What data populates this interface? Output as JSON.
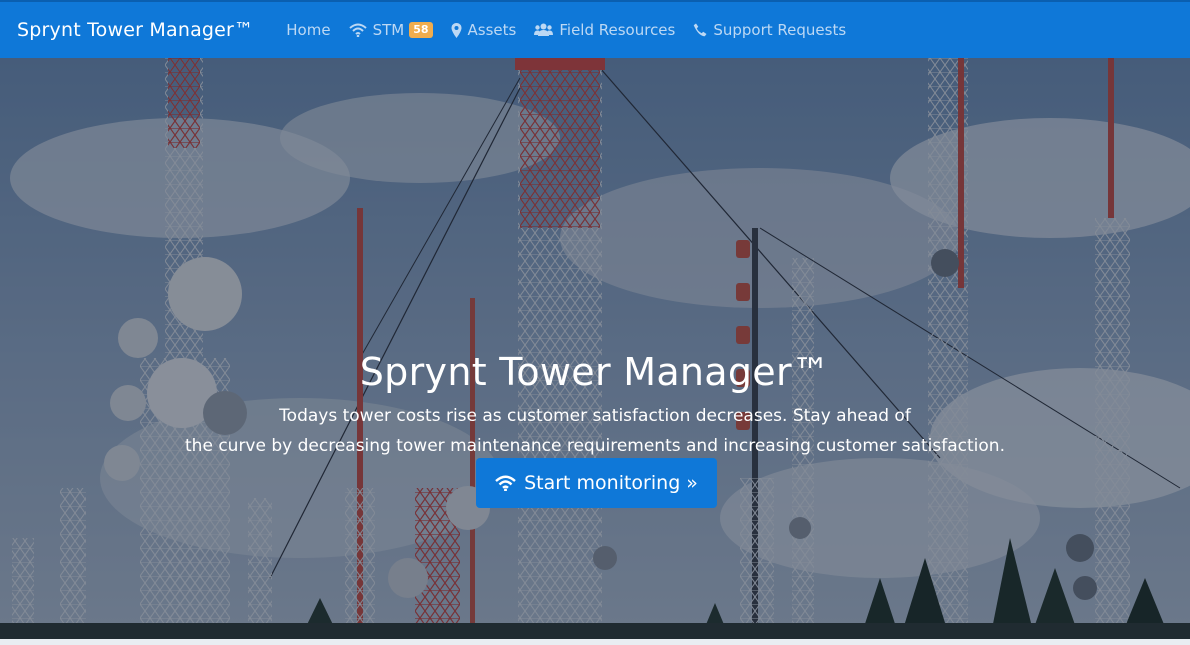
{
  "navbar": {
    "brand": "Sprynt Tower Manager™",
    "items": [
      {
        "label": "Home",
        "icon": "none"
      },
      {
        "label": "STM",
        "icon": "wifi-icon",
        "badge": "58"
      },
      {
        "label": "Assets",
        "icon": "map-marker-icon"
      },
      {
        "label": "Field Resources",
        "icon": "users-icon"
      },
      {
        "label": "Support Requests",
        "icon": "phone-icon"
      }
    ],
    "colors": {
      "bar": "#0f78d8",
      "link": "#bcd8f4",
      "badge": "#f0ad4e"
    }
  },
  "hero": {
    "title": "Sprynt Tower Manager™",
    "text_line1": "Todays tower costs rise as customer satisfaction decreases. Stay ahead of",
    "text_line2": "the curve by decreasing tower maintenance requirements and increasing customer satisfaction.",
    "button_label": "Start monitoring »",
    "button_icon": "wifi-icon"
  }
}
